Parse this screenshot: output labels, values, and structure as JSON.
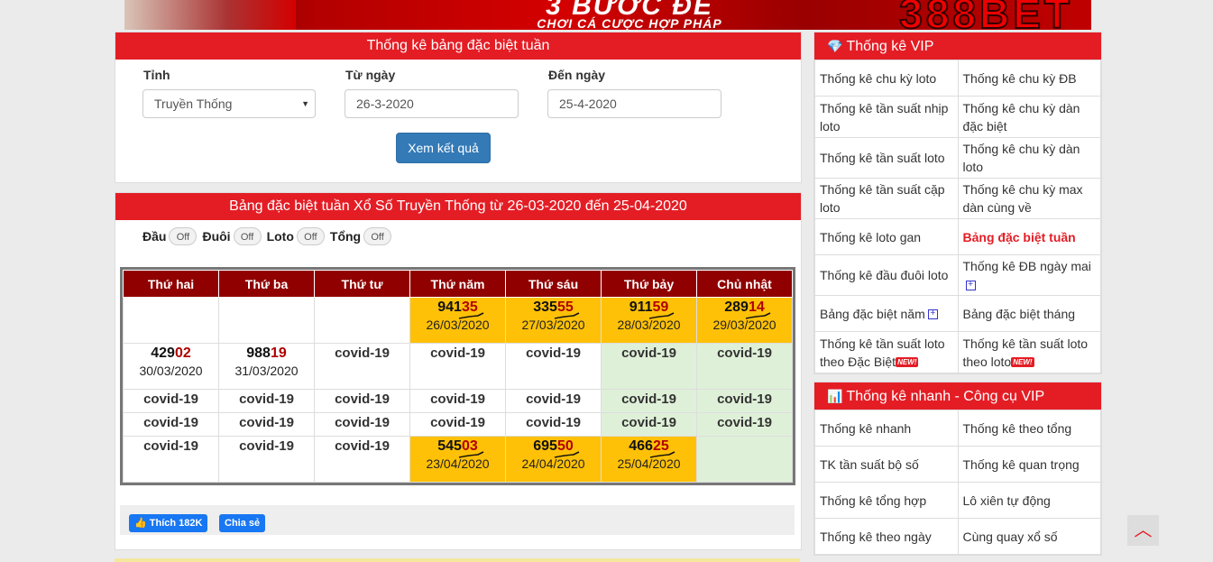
{
  "banner": {
    "headline": "3 BƯỚC ĐỀ",
    "slogan": "CHƠI CÁ CƯỢC HỢP PHÁP",
    "brand": "388BET"
  },
  "filter": {
    "title": "Thống kê bảng đặc biệt tuần",
    "province_label": "Tỉnh",
    "province_value": "Truyền Thống",
    "from_label": "Từ ngày",
    "from_value": "26-3-2020",
    "to_label": "Đến ngày",
    "to_value": "25-4-2020",
    "submit_label": "Xem kết quả"
  },
  "result": {
    "title": "Bảng đặc biệt tuần Xổ Số Truyền Thống từ 26-03-2020 đến 25-04-2020",
    "toggles": [
      {
        "label": "Đầu",
        "state": "Off"
      },
      {
        "label": "Đuôi",
        "state": "Off"
      },
      {
        "label": "Loto",
        "state": "Off"
      },
      {
        "label": "Tổng",
        "state": "Off"
      }
    ],
    "days": [
      "Thứ hai",
      "Thứ ba",
      "Thứ tư",
      "Thứ năm",
      "Thứ sáu",
      "Thứ bảy",
      "Chủ nhật"
    ],
    "rows": [
      [
        {
          "kind": "empty"
        },
        {
          "kind": "empty"
        },
        {
          "kind": "empty"
        },
        {
          "kind": "num",
          "head": "941",
          "tail": "35",
          "date": "26/03/2020",
          "hl": "win"
        },
        {
          "kind": "num",
          "head": "335",
          "tail": "55",
          "date": "27/03/2020",
          "hl": "win"
        },
        {
          "kind": "num",
          "head": "911",
          "tail": "59",
          "date": "28/03/2020",
          "hl": "win"
        },
        {
          "kind": "num",
          "head": "289",
          "tail": "14",
          "date": "29/03/2020",
          "hl": "win"
        }
      ],
      [
        {
          "kind": "num",
          "head": "429",
          "tail": "02",
          "date": "30/03/2020",
          "hl": ""
        },
        {
          "kind": "num",
          "head": "988",
          "tail": "19",
          "date": "31/03/2020",
          "hl": ""
        },
        {
          "kind": "text",
          "text": "covid-19",
          "hl": ""
        },
        {
          "kind": "text",
          "text": "covid-19",
          "hl": ""
        },
        {
          "kind": "text",
          "text": "covid-19",
          "hl": ""
        },
        {
          "kind": "text",
          "text": "covid-19",
          "hl": "green"
        },
        {
          "kind": "text",
          "text": "covid-19",
          "hl": "green"
        }
      ],
      [
        {
          "kind": "text",
          "text": "covid-19",
          "hl": ""
        },
        {
          "kind": "text",
          "text": "covid-19",
          "hl": ""
        },
        {
          "kind": "text",
          "text": "covid-19",
          "hl": ""
        },
        {
          "kind": "text",
          "text": "covid-19",
          "hl": ""
        },
        {
          "kind": "text",
          "text": "covid-19",
          "hl": ""
        },
        {
          "kind": "text",
          "text": "covid-19",
          "hl": "green"
        },
        {
          "kind": "text",
          "text": "covid-19",
          "hl": "green"
        }
      ],
      [
        {
          "kind": "text",
          "text": "covid-19",
          "hl": ""
        },
        {
          "kind": "text",
          "text": "covid-19",
          "hl": ""
        },
        {
          "kind": "text",
          "text": "covid-19",
          "hl": ""
        },
        {
          "kind": "text",
          "text": "covid-19",
          "hl": ""
        },
        {
          "kind": "text",
          "text": "covid-19",
          "hl": ""
        },
        {
          "kind": "text",
          "text": "covid-19",
          "hl": "green"
        },
        {
          "kind": "text",
          "text": "covid-19",
          "hl": "green"
        }
      ],
      [
        {
          "kind": "text",
          "text": "covid-19",
          "hl": ""
        },
        {
          "kind": "text",
          "text": "covid-19",
          "hl": ""
        },
        {
          "kind": "text",
          "text": "covid-19",
          "hl": ""
        },
        {
          "kind": "num",
          "head": "545",
          "tail": "03",
          "date": "23/04/2020",
          "hl": "win"
        },
        {
          "kind": "num",
          "head": "695",
          "tail": "50",
          "date": "24/04/2020",
          "hl": "win"
        },
        {
          "kind": "num",
          "head": "466",
          "tail": "25",
          "date": "25/04/2020",
          "hl": "win"
        },
        {
          "kind": "empty",
          "hl": "green"
        }
      ]
    ],
    "share": {
      "like_label": "Thích 182K",
      "share_label": "Chia sẻ"
    }
  },
  "vip": {
    "title": "Thống kê VIP",
    "icon": "diamond-icon",
    "rows": [
      [
        {
          "label": "Thống kê chu kỳ loto"
        },
        {
          "label": "Thống kê chu kỳ ĐB"
        }
      ],
      [
        {
          "label": "Thống kê tần suất nhịp loto"
        },
        {
          "label": "Thống kê chu kỳ dàn đặc biệt"
        }
      ],
      [
        {
          "label": "Thống kê tần suất loto"
        },
        {
          "label": "Thống kê chu kỳ dàn loto"
        }
      ],
      [
        {
          "label": "Thống kê tần suất cặp loto"
        },
        {
          "label": "Thống kê chu kỳ max dàn cùng về"
        }
      ],
      [
        {
          "label": "Thống kê loto gan"
        },
        {
          "label": "Bảng đặc biệt tuần",
          "active": true
        }
      ],
      [
        {
          "label": "Thống kê đầu đuôi loto"
        },
        {
          "label": "Thống kê ĐB ngày mai",
          "plus": true
        }
      ],
      [
        {
          "label": "Bảng đặc biệt năm",
          "plus": true
        },
        {
          "label": "Bảng đặc biệt tháng"
        }
      ],
      [
        {
          "label": "Thống kê tần suất loto theo Đặc Biệt",
          "new": true
        },
        {
          "label": "Thống kê tần suất loto theo loto",
          "new": true
        }
      ]
    ],
    "new_badge": "NEW!"
  },
  "quick": {
    "title": "Thống kê nhanh - Công cụ VIP",
    "icon": "bar-chart-icon",
    "rows": [
      [
        "Thống kê nhanh",
        "Thống kê theo tổng"
      ],
      [
        "TK tần suất bộ số",
        "Thống kê quan trọng"
      ],
      [
        "Thống kê tổng hợp",
        "Lô xiên tự động"
      ],
      [
        "Thống kê theo ngày",
        "Cùng quay xổ số"
      ]
    ]
  },
  "colors": {
    "header_red": "#e41d25",
    "day_header": "#900000",
    "win_cell": "#ffc107",
    "green_cell": "#dff0d8",
    "button_blue": "#337ab7"
  }
}
